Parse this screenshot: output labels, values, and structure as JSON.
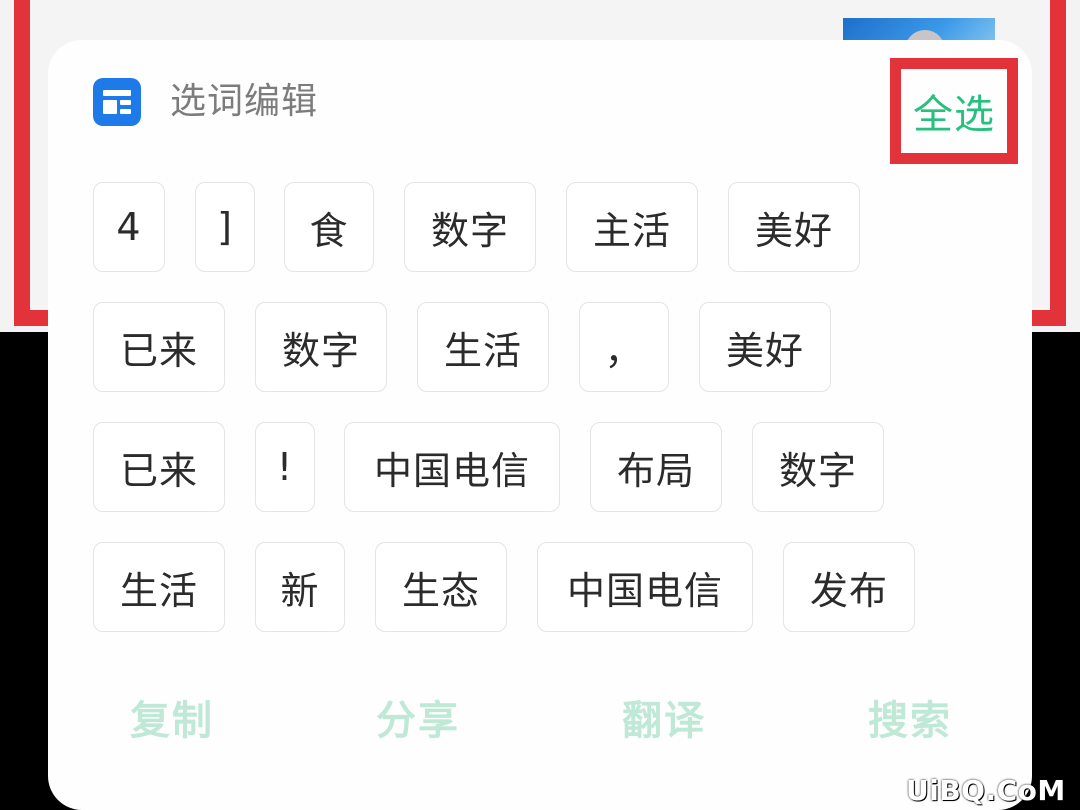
{
  "panel": {
    "title": "选词编辑",
    "select_all_label": "全选",
    "icon": "word-editor-icon"
  },
  "words": [
    [
      "4",
      "]",
      "食",
      "数字",
      "主活",
      "美好"
    ],
    [
      "已来",
      "数字",
      "生活",
      "，",
      "美好"
    ],
    [
      "已来",
      "!",
      "中国电信",
      "布局",
      "数字"
    ],
    [
      "生活",
      "新",
      "生态",
      "中国电信",
      "发布"
    ]
  ],
  "actions": {
    "copy": "复制",
    "share": "分享",
    "translate": "翻译",
    "search": "搜索"
  },
  "colors": {
    "accent_green": "#27c07e",
    "disabled_green": "#bfe9d6",
    "highlight_red": "#e2333a",
    "icon_blue": "#1f7ae9"
  },
  "watermark": "UiBQ.CoM"
}
